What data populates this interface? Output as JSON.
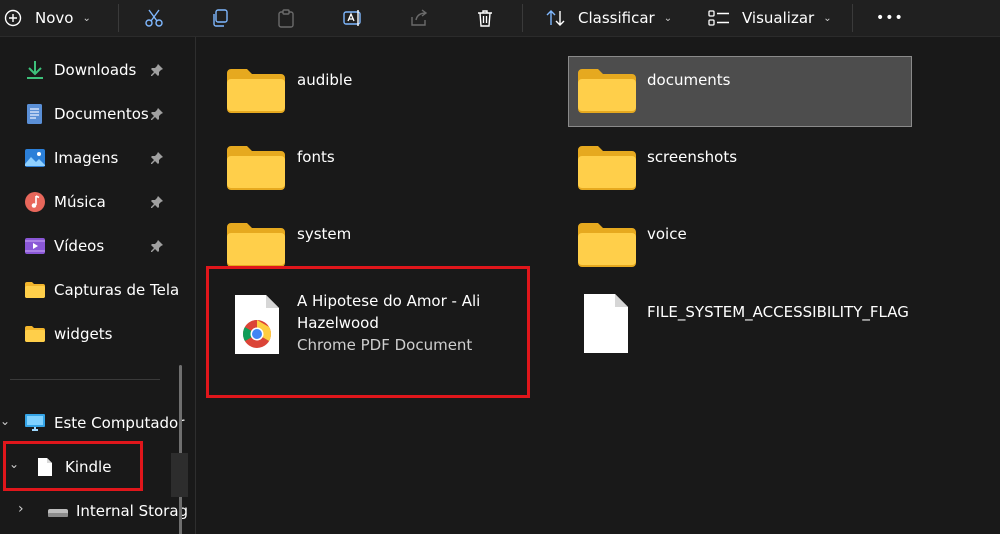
{
  "toolbar": {
    "new_label": "Novo",
    "sort_label": "Classificar",
    "view_label": "Visualizar",
    "more_label": "•••"
  },
  "sidebar": {
    "pinned": [
      {
        "label": "Downloads",
        "icon": "download-icon"
      },
      {
        "label": "Documentos",
        "icon": "documents-icon"
      },
      {
        "label": "Imagens",
        "icon": "pictures-icon"
      },
      {
        "label": "Música",
        "icon": "music-icon"
      },
      {
        "label": "Vídeos",
        "icon": "videos-icon"
      }
    ],
    "folders": [
      {
        "label": "Capturas de Tela",
        "icon": "folder-icon"
      },
      {
        "label": "widgets",
        "icon": "folder-icon"
      }
    ],
    "this_pc": "Este Computador",
    "kindle": "Kindle",
    "internal_storage": "Internal Storage"
  },
  "content": {
    "folders": [
      "audible",
      "documents",
      "fonts",
      "screenshots",
      "system",
      "voice"
    ],
    "pdf_file": {
      "name_line1": "A Hipotese do Amor - Ali",
      "name_line2": "Hazelwood",
      "type": "Chrome PDF Document"
    },
    "flag_file": "FILE_SYSTEM_ACCESSIBILITY_FLAG"
  },
  "colors": {
    "highlight_red": "#e0161b",
    "folder_yellow": "#ffc83d",
    "selection_bg": "#4d4d4d"
  }
}
